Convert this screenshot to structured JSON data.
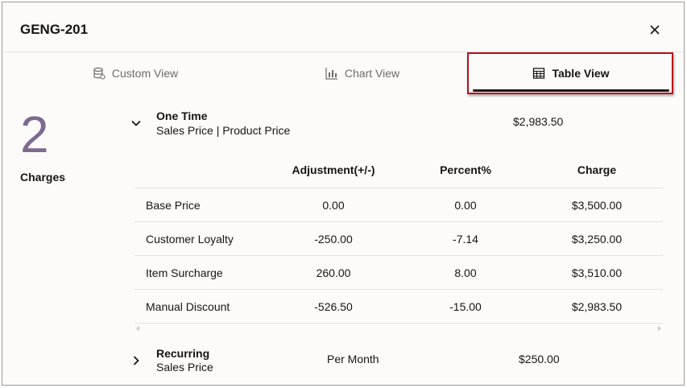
{
  "dialog": {
    "title": "GENG-201"
  },
  "tabs": [
    {
      "label": "Custom View",
      "icon": "database-icon",
      "active": false
    },
    {
      "label": "Chart View",
      "icon": "bar-chart-icon",
      "active": false
    },
    {
      "label": "Table View",
      "icon": "table-icon",
      "active": true
    }
  ],
  "summary": {
    "count": "2",
    "label": "Charges"
  },
  "groups": [
    {
      "title": "One Time",
      "subtitle": "Sales Price | Product Price",
      "amount": "$2,983.50",
      "expanded": true,
      "table": {
        "columns": [
          "Adjustment(+/-)",
          "Percent%",
          "Charge"
        ],
        "rows": [
          [
            "Base Price",
            "0.00",
            "0.00",
            "$3,500.00"
          ],
          [
            "Customer Loyalty",
            "-250.00",
            "-7.14",
            "$3,250.00"
          ],
          [
            "Item Surcharge",
            "260.00",
            "8.00",
            "$3,510.00"
          ],
          [
            "Manual Discount",
            "-526.50",
            "-15.00",
            "$2,983.50"
          ]
        ]
      }
    },
    {
      "title": "Recurring",
      "subtitle": "Sales Price",
      "period": "Per Month",
      "amount": "$250.00",
      "expanded": false
    }
  ],
  "colors": {
    "accent": "#7e6a8e",
    "highlight": "#b5121b"
  }
}
